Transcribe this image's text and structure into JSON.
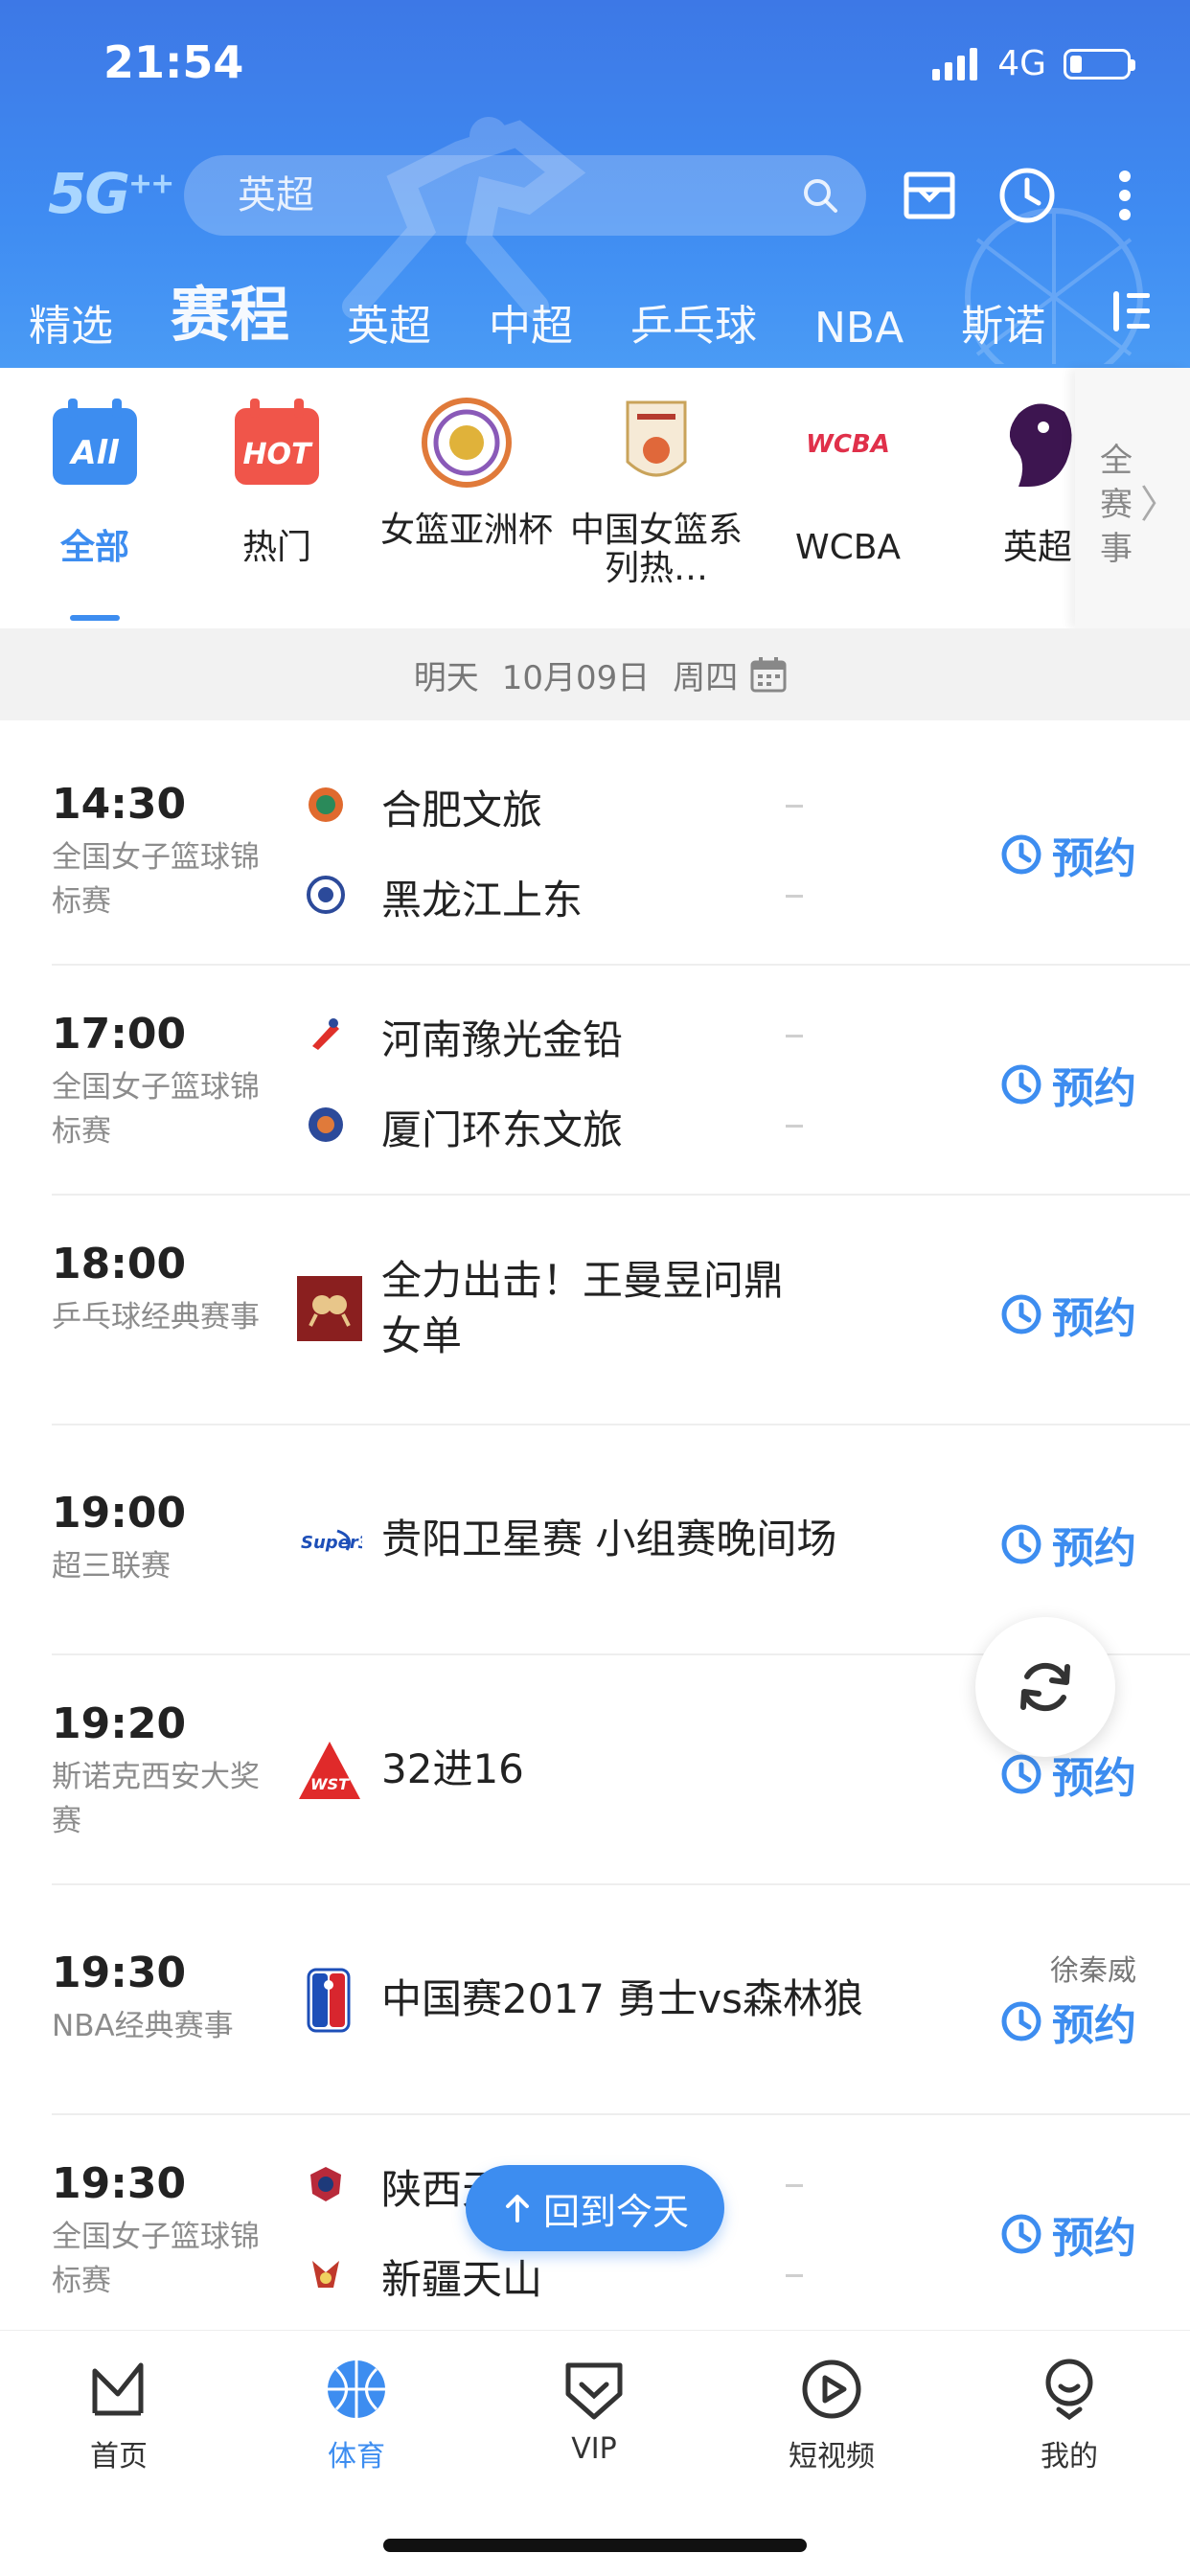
{
  "status_bar": {
    "time": "21:54",
    "network": "4G"
  },
  "header": {
    "logo": "5G",
    "search_placeholder": "英超",
    "tabs": [
      {
        "label": "精选",
        "active": false
      },
      {
        "label": "赛程",
        "active": true
      },
      {
        "label": "英超",
        "active": false
      },
      {
        "label": "中超",
        "active": false
      },
      {
        "label": "乒乓球",
        "active": false
      },
      {
        "label": "NBA",
        "active": false
      },
      {
        "label": "斯诺",
        "active": false
      }
    ]
  },
  "categories": [
    {
      "label": "全部",
      "icon": "all-icon",
      "active": true
    },
    {
      "label": "热门",
      "icon": "hot-icon",
      "active": false
    },
    {
      "label": "女篮亚洲杯",
      "icon": "asia-cup-icon",
      "active": false
    },
    {
      "label": "中国女篮系列热…",
      "icon": "team-china-icon",
      "active": false
    },
    {
      "label": "WCBA",
      "icon": "wcba-icon",
      "active": false
    },
    {
      "label": "英超",
      "icon": "premier-league-icon",
      "active": false
    }
  ],
  "all_competitions": "全赛事",
  "date_bar": {
    "day": "明天",
    "date": "10月09日",
    "weekday": "周四"
  },
  "matches": [
    {
      "time": "14:30",
      "league": "全国女子篮球锦标赛",
      "home": "合肥文旅",
      "away": "黑龙江上东",
      "home_score": "–",
      "away_score": "–",
      "action": "预约"
    },
    {
      "time": "17:00",
      "league": "全国女子篮球锦标赛",
      "home": "河南豫光金铅",
      "away": "厦门环东文旅",
      "home_score": "–",
      "away_score": "–",
      "action": "预约"
    },
    {
      "time": "18:00",
      "league": "乒乓球经典赛事",
      "title": "全力出击！王曼昱问鼎女单",
      "action": "预约"
    },
    {
      "time": "19:00",
      "league": "超三联赛",
      "title": "贵阳卫星赛 小组赛晚间场",
      "action": "预约"
    },
    {
      "time": "19:20",
      "league": "斯诺克西安大奖赛",
      "title": "32进16",
      "action": "预约"
    },
    {
      "time": "19:30",
      "league": "NBA经典赛事",
      "title": "中国赛2017 勇士vs森林狼",
      "commentator": "徐秦威",
      "action": "预约"
    },
    {
      "time": "19:30",
      "league": "全国女子篮球锦标赛",
      "home": "陕西天",
      "away": "新疆天山",
      "home_score": "–",
      "away_score": "–",
      "action": "预约"
    }
  ],
  "floating": {
    "back_today": "回到今天"
  },
  "bottom_nav": [
    {
      "label": "首页",
      "icon": "home-icon",
      "active": false
    },
    {
      "label": "体育",
      "icon": "sports-icon",
      "active": true
    },
    {
      "label": "VIP",
      "icon": "vip-icon",
      "active": false
    },
    {
      "label": "短视频",
      "icon": "short-video-icon",
      "active": false
    },
    {
      "label": "我的",
      "icon": "profile-icon",
      "active": false
    }
  ],
  "colors": {
    "primary": "#3d8df0",
    "header": "#3f8cf2"
  }
}
